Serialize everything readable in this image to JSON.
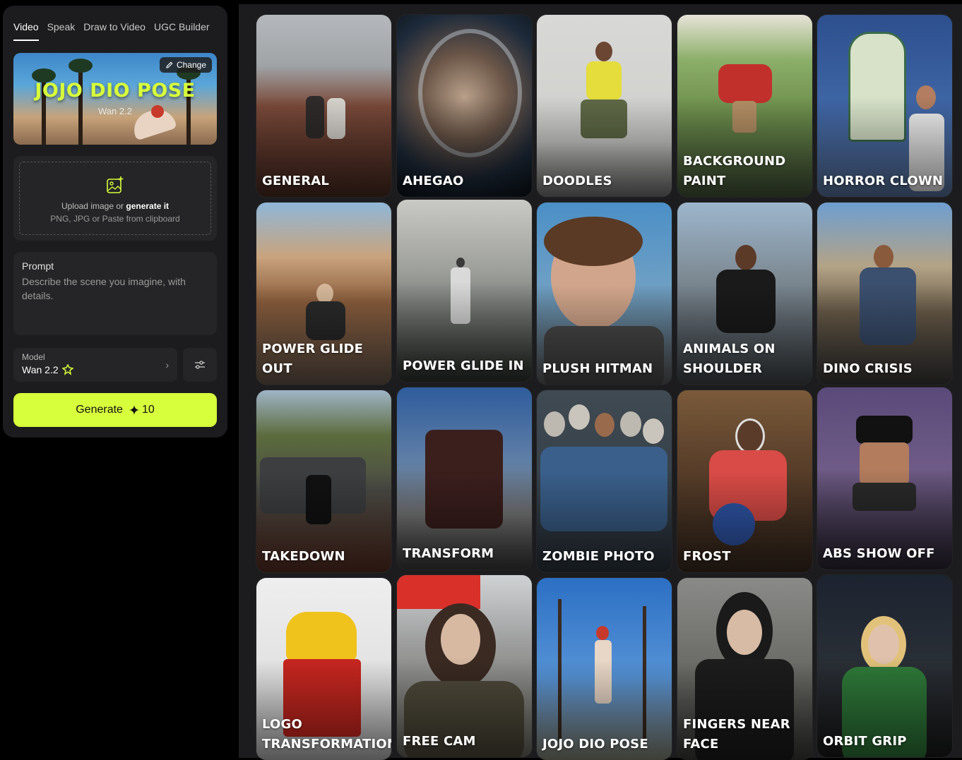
{
  "tabs": [
    {
      "label": "Video",
      "active": true
    },
    {
      "label": "Speak",
      "active": false
    },
    {
      "label": "Draw to Video",
      "active": false
    },
    {
      "label": "UGC Builder",
      "active": false
    }
  ],
  "preset": {
    "title": "JOJO DIO POSE",
    "subtitle": "Wan 2.2",
    "change_label": "Change"
  },
  "upload": {
    "text_prefix": "Upload image or",
    "text_link": "generate it",
    "formats": "PNG, JPG or Paste from clipboard",
    "icon": "image-add-icon"
  },
  "prompt": {
    "label": "Prompt",
    "placeholder": "Describe the scene you imagine, with details."
  },
  "model": {
    "label": "Model",
    "value": "Wan 2.2",
    "badge_icon": "wan-logo-icon"
  },
  "generate": {
    "label": "Generate",
    "credits": "10",
    "icon": "sparkle-icon",
    "color": "#d8ff3c"
  },
  "presets": [
    {
      "label": "GENERAL"
    },
    {
      "label": "AHEGAO"
    },
    {
      "label": "DOODLES"
    },
    {
      "label": "BACKGROUND PAINT"
    },
    {
      "label": "HORROR CLOWN"
    },
    {
      "label": "POWER GLIDE OUT"
    },
    {
      "label": "POWER GLIDE IN"
    },
    {
      "label": "PLUSH HITMAN"
    },
    {
      "label": "ANIMALS ON SHOULDER"
    },
    {
      "label": "DINO CRISIS"
    },
    {
      "label": "TAKEDOWN"
    },
    {
      "label": "TRANSFORM"
    },
    {
      "label": "ZOMBIE PHOTO"
    },
    {
      "label": "FROST"
    },
    {
      "label": "ABS SHOW OFF"
    },
    {
      "label": "LOGO TRANSFORMATION"
    },
    {
      "label": "FREE CAM"
    },
    {
      "label": "JOJO DIO POSE"
    },
    {
      "label": "FINGERS NEAR FACE"
    },
    {
      "label": "ORBIT GRIP"
    }
  ]
}
